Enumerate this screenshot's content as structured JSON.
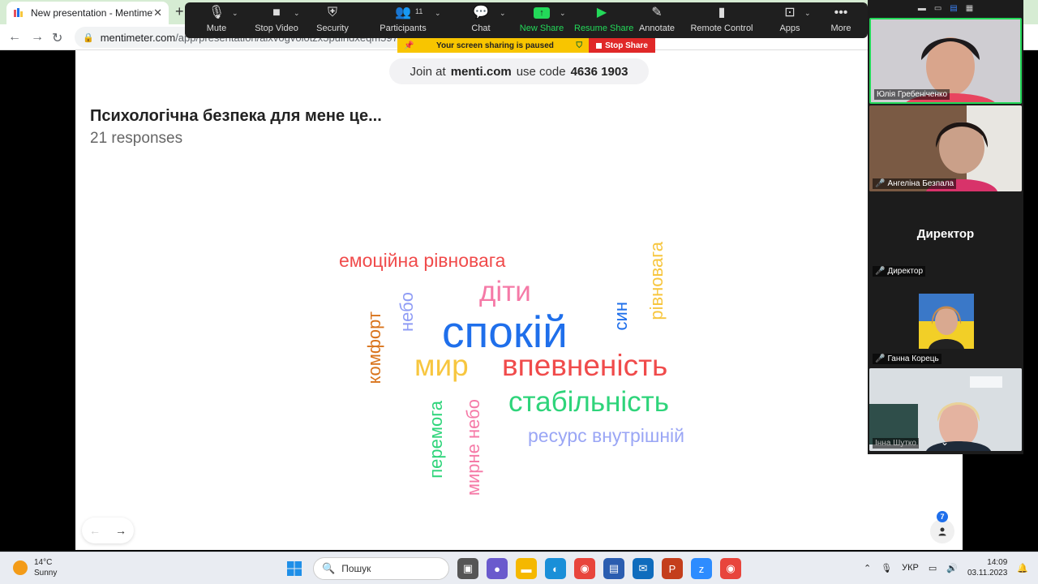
{
  "browser": {
    "tab_title": "New presentation - Mentimeter",
    "tab_close": "✕",
    "new_tab": "+",
    "url_host": "mentimeter.com",
    "url_path": "/app/presentation/alxvogvolotzx5puindxeqm5974nioy/"
  },
  "zoom_toolbar": {
    "participants_count": "11",
    "buttons": [
      {
        "label": "Mute",
        "icon": "microphone-icon"
      },
      {
        "label": "Stop Video",
        "icon": "video-camera-icon"
      },
      {
        "label": "Security",
        "icon": "shield-icon"
      },
      {
        "label": "Participants",
        "icon": "participants-icon"
      },
      {
        "label": "Chat",
        "icon": "chat-bubble-icon"
      },
      {
        "label": "New Share",
        "icon": "share-up-arrow-icon"
      },
      {
        "label": "Resume Share",
        "icon": "play-icon"
      },
      {
        "label": "Annotate",
        "icon": "pencil-icon"
      },
      {
        "label": "Remote Control",
        "icon": "mouse-icon"
      },
      {
        "label": "Apps",
        "icon": "apps-icon"
      },
      {
        "label": "More",
        "icon": "more-dots-icon"
      }
    ],
    "accent_color": "#23d959"
  },
  "share_banner": {
    "paused_text": "Your screen sharing is paused",
    "stop_label": "Stop Share",
    "banner_color": "#f8c500",
    "stop_color": "#e02828"
  },
  "slide": {
    "join_prefix": "Join at",
    "join_site": "menti.com",
    "join_use_code": "use code",
    "join_code": "4636 1903",
    "question": "Психологічна безпека для мене це...",
    "responses": "21 responses",
    "audience_count": "7"
  },
  "word_cloud": [
    {
      "text": "емоційна рівновага",
      "color": "#f04b4b"
    },
    {
      "text": "діти",
      "color": "#f57aa7"
    },
    {
      "text": "небо",
      "color": "#8f9cf5"
    },
    {
      "text": "спокій",
      "color": "#1f6feb"
    },
    {
      "text": "син",
      "color": "#1f6feb"
    },
    {
      "text": "рівновага",
      "color": "#f7c63f"
    },
    {
      "text": "комфорт",
      "color": "#d9731b"
    },
    {
      "text": "мир",
      "color": "#f7c63f"
    },
    {
      "text": "впевненість",
      "color": "#f04b4b"
    },
    {
      "text": "стабільність",
      "color": "#2ed47a"
    },
    {
      "text": "ресурс внутрішній",
      "color": "#9aa6f5"
    },
    {
      "text": "перемога",
      "color": "#2ed47a"
    },
    {
      "text": "мирне небо",
      "color": "#f57aa7"
    }
  ],
  "gallery": {
    "participants": [
      {
        "name": "Юлія Гребеніченко"
      },
      {
        "name": "Ангеліна Безпала"
      },
      {
        "name": "Директор",
        "display": "Директор"
      },
      {
        "name": "Ганна Корець"
      },
      {
        "name": "Інна Шутко"
      }
    ]
  },
  "taskbar": {
    "temperature": "14°C",
    "weather": "Sunny",
    "search_placeholder": "Пошук",
    "language": "УКР",
    "time": "14:09",
    "date": "03.11.2023"
  }
}
